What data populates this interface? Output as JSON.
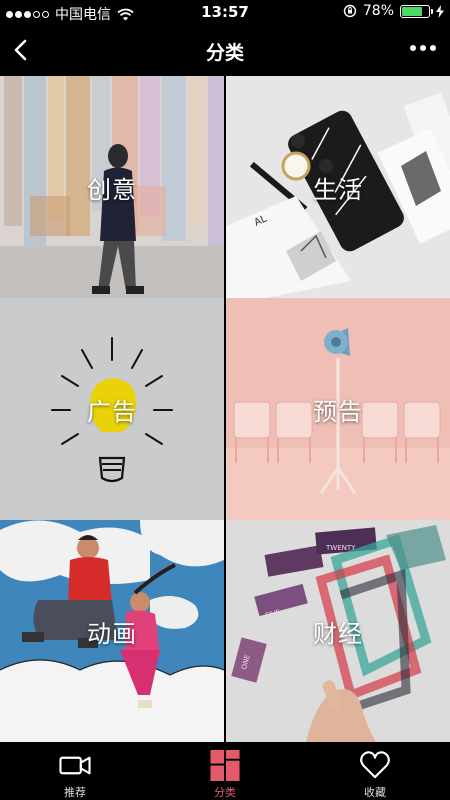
{
  "status_bar": {
    "carrier": "中国电信",
    "time": "13:57",
    "battery": "78%",
    "battery_level": 0.78
  },
  "nav": {
    "title": "分类"
  },
  "categories": [
    {
      "label": "创意"
    },
    {
      "label": "生活"
    },
    {
      "label": "广告"
    },
    {
      "label": "预告"
    },
    {
      "label": "动画"
    },
    {
      "label": "财经"
    }
  ],
  "tabs": [
    {
      "label": "推荐",
      "icon": "video-camera-icon"
    },
    {
      "label": "分类",
      "icon": "category-grid-icon",
      "active": true
    },
    {
      "label": "收藏",
      "icon": "heart-icon"
    }
  ],
  "colors": {
    "accent": "#e35b6b",
    "battery": "#4cd964"
  }
}
